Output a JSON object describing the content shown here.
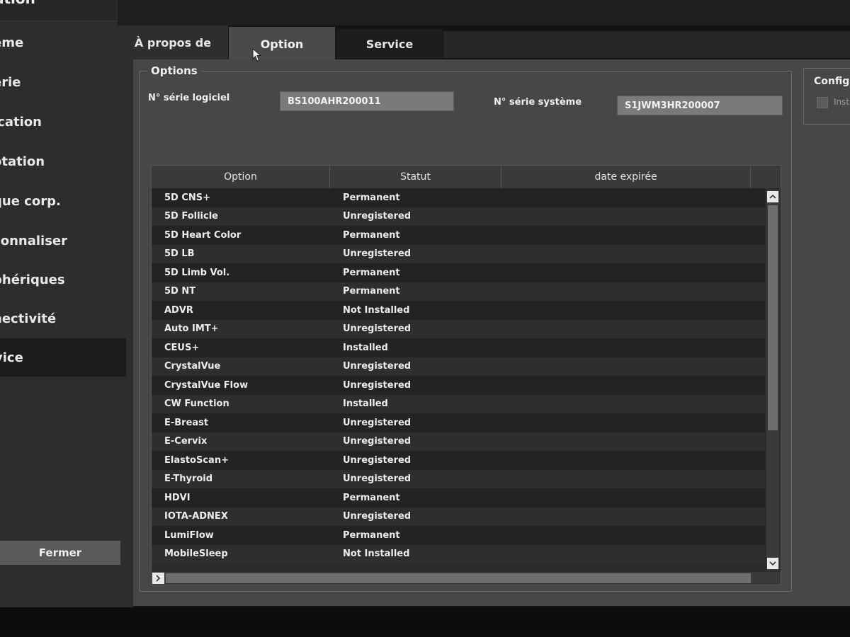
{
  "sidebar": {
    "title": "ation",
    "items": [
      {
        "label": "ème",
        "active": false
      },
      {
        "label": "erie",
        "active": false
      },
      {
        "label": "ication",
        "active": false
      },
      {
        "label": "otation",
        "active": false
      },
      {
        "label": "que corp.",
        "active": false
      },
      {
        "label": "sonnaliser",
        "active": false
      },
      {
        "label": "phériques",
        "active": false
      },
      {
        "label": "nectivité",
        "active": false
      },
      {
        "label": "vice",
        "active": true
      }
    ],
    "close_label": "Fermer"
  },
  "tabs": {
    "about": "À propos de",
    "option": "Option",
    "service": "Service",
    "active": "option"
  },
  "options": {
    "group_title": "Options",
    "software_serial_label": "N° série logiciel",
    "software_serial_value": "BS100AHR200011",
    "system_serial_label": "N° série système",
    "system_serial_value": "S1JWM3HR200007"
  },
  "table": {
    "headers": {
      "option": "Option",
      "status": "Statut",
      "expiry": "date expirée"
    },
    "rows": [
      {
        "name": "5D CNS+",
        "status": "Permanent",
        "expiry": ""
      },
      {
        "name": "5D Follicle",
        "status": "Unregistered",
        "expiry": ""
      },
      {
        "name": "5D Heart Color",
        "status": "Permanent",
        "expiry": ""
      },
      {
        "name": "5D LB",
        "status": "Unregistered",
        "expiry": ""
      },
      {
        "name": "5D Limb Vol.",
        "status": "Permanent",
        "expiry": ""
      },
      {
        "name": "5D NT",
        "status": "Permanent",
        "expiry": ""
      },
      {
        "name": "ADVR",
        "status": "Not Installed",
        "expiry": ""
      },
      {
        "name": "Auto IMT+",
        "status": "Unregistered",
        "expiry": ""
      },
      {
        "name": "CEUS+",
        "status": "Installed",
        "expiry": ""
      },
      {
        "name": "CrystalVue",
        "status": "Unregistered",
        "expiry": ""
      },
      {
        "name": "CrystalVue Flow",
        "status": "Unregistered",
        "expiry": ""
      },
      {
        "name": "CW Function",
        "status": "Installed",
        "expiry": ""
      },
      {
        "name": "E-Breast",
        "status": "Unregistered",
        "expiry": ""
      },
      {
        "name": "E-Cervix",
        "status": "Unregistered",
        "expiry": ""
      },
      {
        "name": "ElastoScan+",
        "status": "Unregistered",
        "expiry": ""
      },
      {
        "name": "E-Thyroid",
        "status": "Unregistered",
        "expiry": ""
      },
      {
        "name": "HDVI",
        "status": "Permanent",
        "expiry": ""
      },
      {
        "name": "IOTA-ADNEX",
        "status": "Unregistered",
        "expiry": ""
      },
      {
        "name": "LumiFlow",
        "status": "Permanent",
        "expiry": ""
      },
      {
        "name": "MobileSleep",
        "status": "Not Installed",
        "expiry": ""
      }
    ]
  },
  "config_panel": {
    "title": "Configur",
    "checkbox_label": "Insta"
  },
  "icons": {
    "scroll_up": "chevron-up-icon",
    "scroll_down": "chevron-down-icon",
    "scroll_left": "chevron-left-icon",
    "scroll_right": "chevron-right-icon",
    "cursor": "mouse-pointer-icon"
  }
}
